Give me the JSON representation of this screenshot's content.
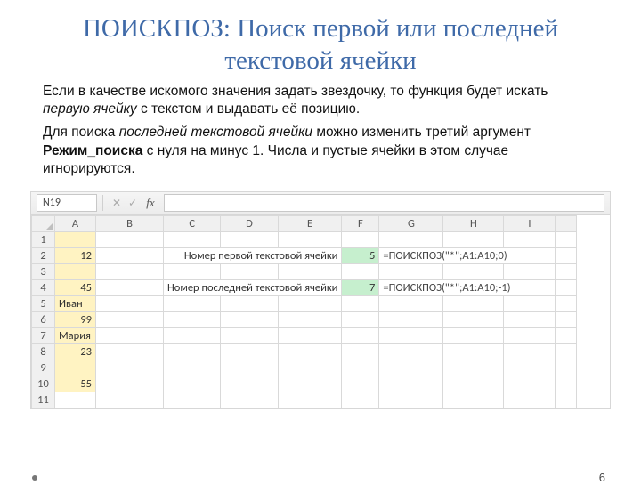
{
  "title": "ПОИСКПОЗ: Поиск первой или последней текстовой ячейки",
  "para1_a": "Если в качестве искомого значения задать звездочку, то функция будет искать ",
  "para1_em": "первую ячейку",
  "para1_b": " с текстом и выдавать её позицию.",
  "para2_a": "Для поиска ",
  "para2_em": "последней текстовой ячейки",
  "para2_b": " можно изменить третий аргумент ",
  "para2_strong": "Режим_поиска",
  "para2_c": " с нуля на минус 1. Числа и пустые ячейки в этом случае игнорируются.",
  "namebox": "N19",
  "fx_label": "fx",
  "columns": [
    "A",
    "B",
    "C",
    "D",
    "E",
    "F",
    "G",
    "H",
    "I"
  ],
  "rows": [
    "1",
    "2",
    "3",
    "4",
    "5",
    "6",
    "7",
    "8",
    "9",
    "10",
    "11"
  ],
  "colA": {
    "2": "12",
    "4": "45",
    "5": "Иван",
    "6": "99",
    "7": "Мария",
    "8": "23",
    "10": "55"
  },
  "label_first": "Номер первой текстовой ячейки",
  "label_last": "Номер последней текстовой ячейки",
  "result_first": "5",
  "result_last": "7",
  "formula_first": "=ПОИСКПОЗ(\"*\";A1:A10;0)",
  "formula_last": "=ПОИСКПОЗ(\"*\";A1:A10;-1)",
  "page": "6"
}
